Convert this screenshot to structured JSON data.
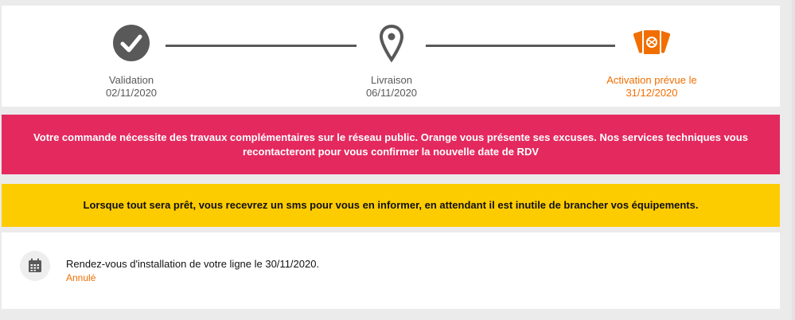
{
  "tracker": {
    "steps": [
      {
        "label": "Validation",
        "date": "02/11/2020",
        "icon": "check-circle-icon",
        "status": "done"
      },
      {
        "label": "Livraison",
        "date": "06/11/2020",
        "icon": "map-pin-icon",
        "status": "done"
      },
      {
        "label": "Activation prévue le",
        "date": "31/12/2020",
        "icon": "activation-cards-icon",
        "status": "current"
      }
    ]
  },
  "alerts": {
    "red_message": "Votre commande nécessite des travaux complémentaires sur le réseau public. Orange vous présente ses excuses. Nos services techniques vous recontacteront pour vous confirmer la nouvelle date de RDV",
    "yellow_message": "Lorsque tout sera prêt, vous recevrez un sms pour vous en informer, en attendant il est inutile de brancher vos équipements."
  },
  "appointment": {
    "icon": "calendar-icon",
    "text": "Rendez-vous d'installation de votre ligne le 30/11/2020.",
    "status": "Annulé"
  },
  "colors": {
    "accent": "#f16e00",
    "alert_red": "#e4295f",
    "alert_yellow": "#fdcc00",
    "step_grey": "#595959"
  }
}
